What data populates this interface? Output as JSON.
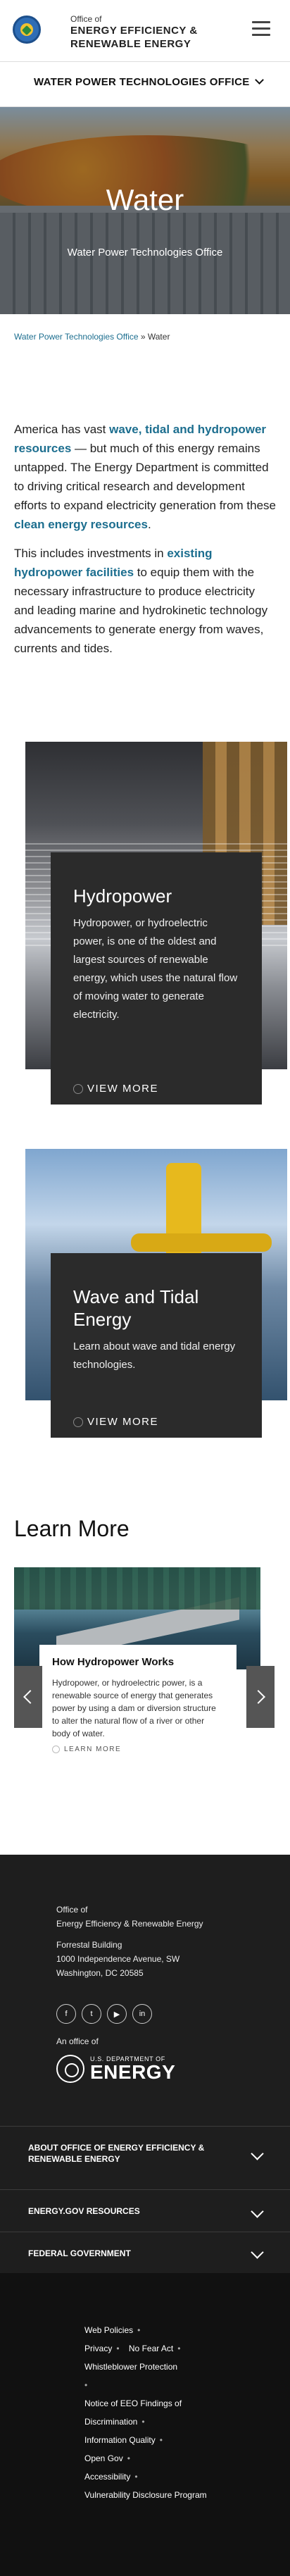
{
  "header": {
    "office_of": "Office of",
    "title": "ENERGY EFFICIENCY & RENEWABLE ENERGY"
  },
  "office_nav": {
    "label": "WATER POWER TECHNOLOGIES OFFICE"
  },
  "hero": {
    "title": "Water",
    "subtitle": "Water Power Technologies Office"
  },
  "breadcrumb": {
    "parent": "Water Power Technologies Office",
    "separator": " » ",
    "current": "Water"
  },
  "intro": {
    "p1": {
      "t1": "America has vast ",
      "link1": "wave, tidal and hydropower resources",
      "t2": " — but much of this energy remains untapped. The Energy Department is committed to driving critical research and development efforts to expand electricity generation from these ",
      "link2": "clean energy resources",
      "t3": "."
    },
    "p2": {
      "t1": "This includes investments in ",
      "link1": "existing hydropower facilities",
      "t2": " to equip them with the necessary infrastructure to produce electricity and leading marine and hydrokinetic technology advancements to generate energy from waves, currents and tides."
    }
  },
  "features": [
    {
      "title": "Hydropower",
      "description": "Hydropower, or hydroelectric power, is one of the oldest and largest sources of renewable energy, which uses the natural flow of moving water to generate electricity.",
      "cta": "VIEW MORE"
    },
    {
      "title": "Wave and Tidal Energy",
      "description": "Learn about wave and tidal energy technologies.",
      "cta": "VIEW MORE"
    }
  ],
  "learn_more": {
    "heading": "Learn More",
    "slide": {
      "title": "How Hydropower Works",
      "description": "Hydropower, or hydroelectric power, is a renewable source of energy that generates power by using a dam or diversion structure to alter the natural flow of a river or other body of water.",
      "cta": "LEARN MORE"
    }
  },
  "footer": {
    "office_of": "Office of",
    "office_name": "Energy Efficiency & Renewable Energy",
    "building": "Forrestal Building",
    "street": "1000 Independence Avenue, SW",
    "city": "Washington, DC 20585",
    "social": [
      {
        "name": "facebook",
        "glyph": "f"
      },
      {
        "name": "twitter",
        "glyph": "t"
      },
      {
        "name": "youtube",
        "glyph": "▶"
      },
      {
        "name": "linkedin",
        "glyph": "in"
      }
    ],
    "an_office_of": "An office of",
    "doe_small": "U.S. DEPARTMENT OF",
    "doe_big": "ENERGY",
    "accordions": [
      "ABOUT OFFICE OF ENERGY EFFICIENCY & RENEWABLE ENERGY",
      "ENERGY.GOV RESOURCES",
      "FEDERAL GOVERNMENT"
    ],
    "links": [
      "Web Policies",
      "Privacy",
      "No Fear Act",
      "Whistleblower Protection",
      "Notice of EEO Findings of Discrimination",
      "Information Quality",
      "Open Gov",
      "Accessibility",
      "Vulnerability Disclosure Program"
    ],
    "link_separator": "•"
  }
}
